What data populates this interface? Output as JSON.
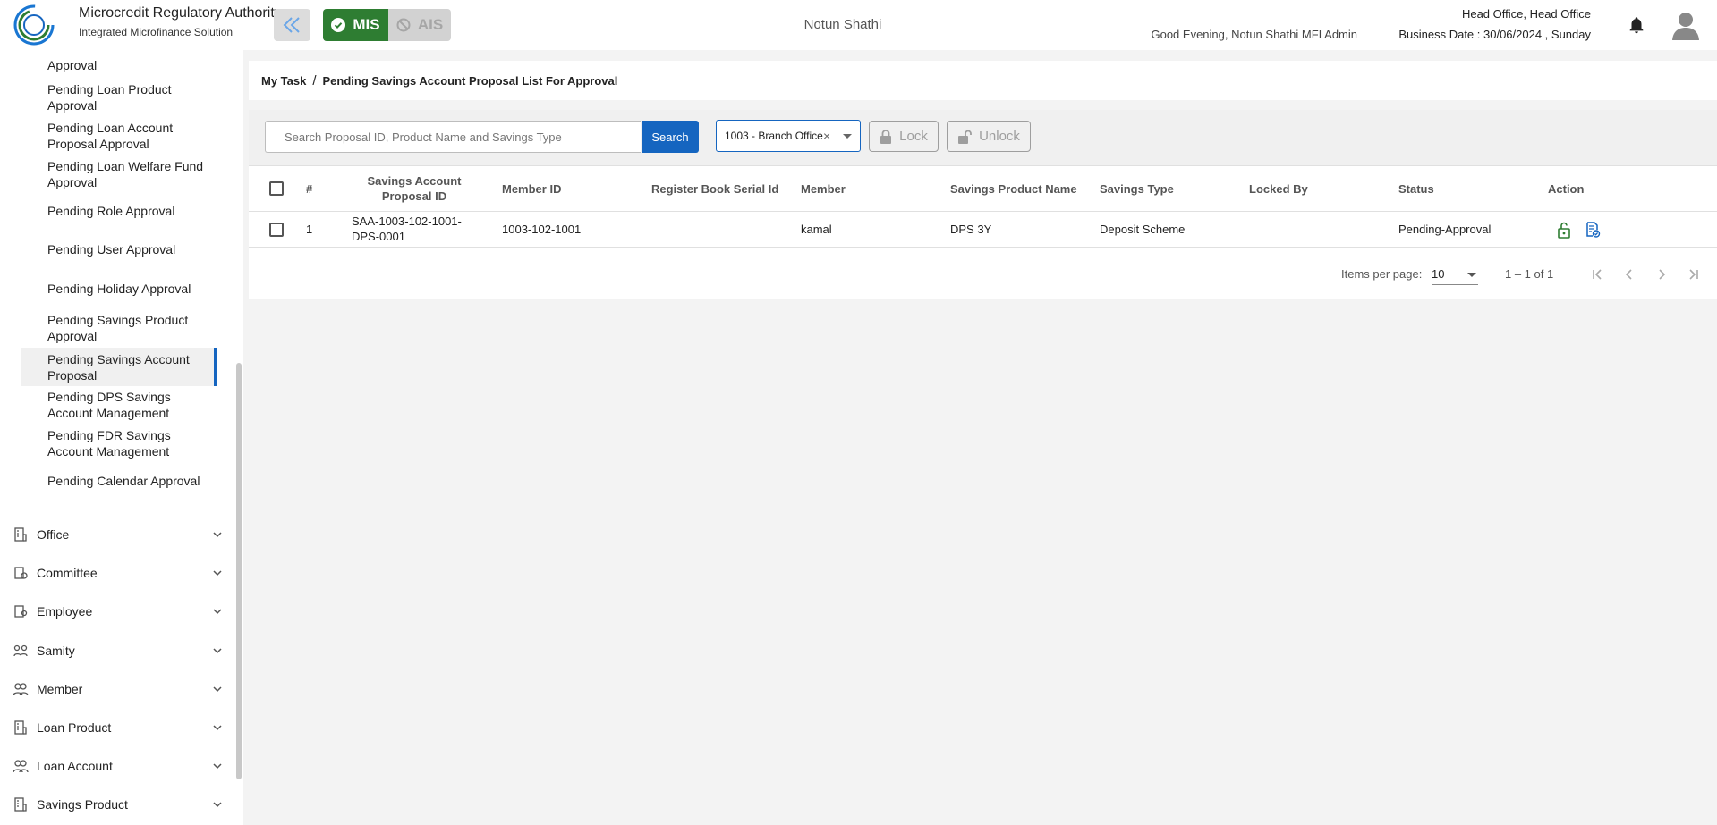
{
  "header": {
    "brand_title": "Microcredit Regulatory Authority",
    "brand_subtitle": "Integrated Microfinance Solution",
    "logo_text": "Microcredit Regulatory Authority",
    "mis_label": "MIS",
    "ais_label": "AIS",
    "organization": "Notun Shathi",
    "greeting": "Good Evening, Notun Shathi MFI Admin",
    "office": "Head Office, Head Office",
    "business_date": "Business Date : 30/06/2024 , Sunday",
    "colors": {
      "mis_active": "#2e7d32",
      "primary": "#1565c0"
    }
  },
  "sidebar": {
    "task_items": [
      {
        "label": "Approval"
      },
      {
        "label": "Pending Loan Product Approval"
      },
      {
        "label": "Pending Loan Account Proposal Approval"
      },
      {
        "label": "Pending Loan Welfare Fund Approval"
      },
      {
        "label": "Pending Role Approval"
      },
      {
        "label": "Pending User Approval"
      },
      {
        "label": "Pending Holiday Approval"
      },
      {
        "label": "Pending Savings Product Approval"
      },
      {
        "label": "Pending Savings Account Proposal",
        "active": true
      },
      {
        "label": "Pending DPS Savings Account Management"
      },
      {
        "label": "Pending FDR Savings Account Management"
      },
      {
        "label": "Pending Calendar Approval"
      }
    ],
    "groups": [
      {
        "label": "Office",
        "icon": "office-icon"
      },
      {
        "label": "Committee",
        "icon": "committee-icon"
      },
      {
        "label": "Employee",
        "icon": "employee-icon"
      },
      {
        "label": "Samity",
        "icon": "samity-icon"
      },
      {
        "label": "Member",
        "icon": "member-icon"
      },
      {
        "label": "Loan Product",
        "icon": "loan-product-icon"
      },
      {
        "label": "Loan Account",
        "icon": "loan-account-icon"
      },
      {
        "label": "Savings Product",
        "icon": "savings-product-icon"
      }
    ]
  },
  "breadcrumb": {
    "root": "My Task",
    "separator": "/",
    "current": "Pending Savings Account Proposal List For Approval"
  },
  "toolbar": {
    "search_placeholder": "Search Proposal ID, Product Name and Savings Type",
    "search_label": "Search",
    "branch_value": "1003 - Branch Office",
    "clear_glyph": "×",
    "lock_label": "Lock",
    "unlock_label": "Unlock"
  },
  "table": {
    "columns": {
      "index": "#",
      "proposal_id": "Savings Account Proposal ID",
      "member_id": "Member ID",
      "register_book": "Register Book Serial Id",
      "member": "Member",
      "product_name": "Savings Product Name",
      "savings_type": "Savings Type",
      "locked_by": "Locked By",
      "status": "Status",
      "action": "Action"
    },
    "rows": [
      {
        "index": "1",
        "proposal_id": "SAA-1003-102-1001-DPS-0001",
        "member_id": "1003-102-1001",
        "register_book": "",
        "member": "kamal",
        "product_name": "DPS 3Y",
        "savings_type": "Deposit Scheme",
        "locked_by": "",
        "status": "Pending-Approval"
      }
    ]
  },
  "pagination": {
    "items_per_page_label": "Items per page:",
    "items_per_page": "10",
    "range": "1 – 1 of 1"
  }
}
